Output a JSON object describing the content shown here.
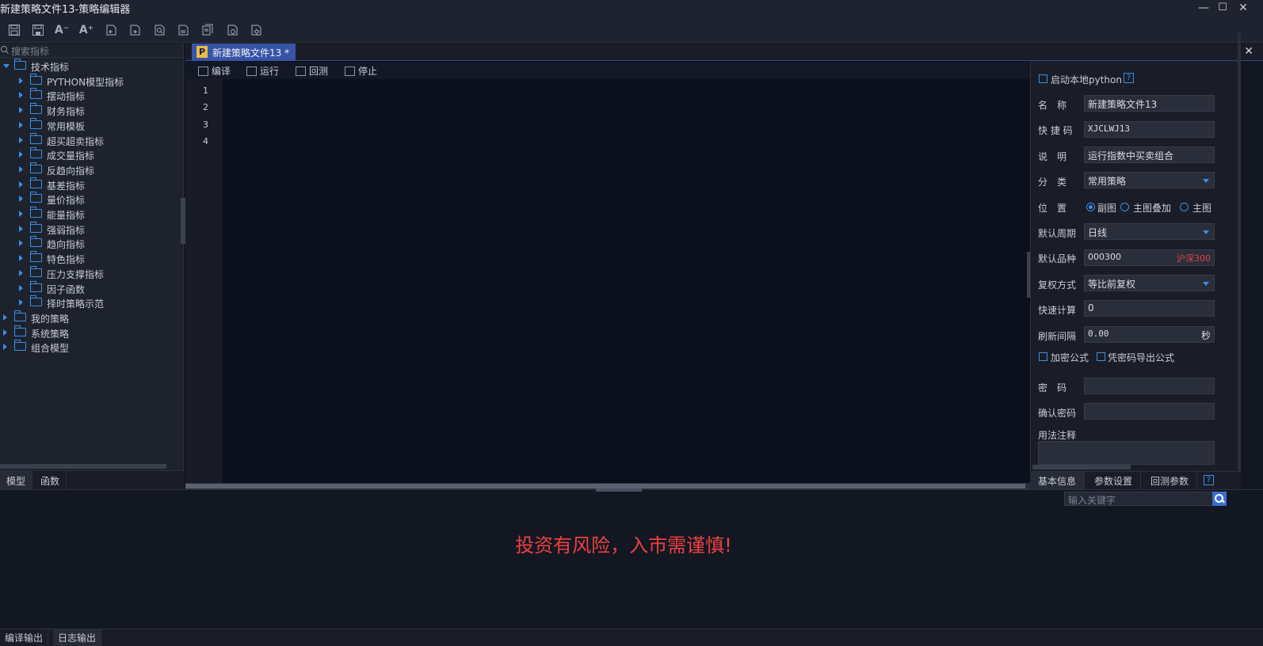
{
  "window": {
    "title": "新建策略文件13-策略编辑器",
    "minimize": "—",
    "maximize": "☐",
    "close": "✕"
  },
  "toolbar": {
    "icons": [
      "save-icon",
      "save-as-icon",
      "font-decrease-icon",
      "font-increase-icon",
      "undo-icon",
      "redo-icon",
      "find-icon",
      "import-icon",
      "export-icon",
      "settings-doc-icon",
      "gear-doc-icon"
    ],
    "font_decrease": "A⁻",
    "font_increase": "A⁺"
  },
  "left_panel": {
    "search_placeholder": "搜索指标",
    "tree": [
      {
        "label": "技术指标",
        "level": 0,
        "open": true
      },
      {
        "label": "PYTHON模型指标",
        "level": 1
      },
      {
        "label": "摆动指标",
        "level": 1
      },
      {
        "label": "财务指标",
        "level": 1
      },
      {
        "label": "常用模板",
        "level": 1
      },
      {
        "label": "超买超卖指标",
        "level": 1
      },
      {
        "label": "成交量指标",
        "level": 1
      },
      {
        "label": "反趋向指标",
        "level": 1
      },
      {
        "label": "基差指标",
        "level": 1
      },
      {
        "label": "量价指标",
        "level": 1
      },
      {
        "label": "能量指标",
        "level": 1
      },
      {
        "label": "强弱指标",
        "level": 1
      },
      {
        "label": "趋向指标",
        "level": 1
      },
      {
        "label": "特色指标",
        "level": 1
      },
      {
        "label": "压力支撑指标",
        "level": 1
      },
      {
        "label": "因子函数",
        "level": 1
      },
      {
        "label": "择时策略示范",
        "level": 1
      },
      {
        "label": "我的策略",
        "level": 0
      },
      {
        "label": "系统策略",
        "level": 0
      },
      {
        "label": "组合模型",
        "level": 0
      }
    ],
    "tabs": [
      "模型",
      "函数"
    ]
  },
  "editor": {
    "tab_label": "新建策略文件13 *",
    "tab_icon": "P",
    "close": "✕",
    "tools": [
      "编译",
      "运行",
      "回测",
      "停止"
    ],
    "line_numbers": [
      "1",
      "2",
      "3",
      "4"
    ]
  },
  "properties": {
    "local_python": "启动本地python",
    "help": "?",
    "name_label": "名　称",
    "name_value": "新建策略文件13",
    "shortcut_label": "快 捷 码",
    "shortcut_value": "XJCLWJ13",
    "desc_label": "说　明",
    "desc_value": "运行指数中买卖组合",
    "category_label": "分　类",
    "category_value": "常用策略",
    "position_label": "位　置",
    "position_options": [
      "副图",
      "主图叠加",
      "主图"
    ],
    "position_selected": "副图",
    "period_label": "默认周期",
    "period_value": "日线",
    "symbol_label": "默认品种",
    "symbol_value": "000300",
    "symbol_name": "沪深300",
    "adjust_label": "复权方式",
    "adjust_value": "等比前复权",
    "quick_calc_label": "快速计算",
    "quick_calc_value": "0",
    "refresh_label": "刷新间隔",
    "refresh_value": "0.00",
    "refresh_unit": "秒",
    "encrypt_label": "加密公式",
    "export_pw_label": "凭密码导出公式",
    "password_label": "密　码",
    "confirm_pw_label": "确认密码",
    "usage_label": "用法注释",
    "tabs": [
      "基本信息",
      "参数设置",
      "回测参数"
    ]
  },
  "output": {
    "search_placeholder": "输入关键字",
    "warning": "投资有风险，入市需谨慎!",
    "tabs": [
      "编译输出",
      "日志输出"
    ]
  },
  "colors": {
    "accent": "#3a8ee6",
    "tab_active": "#3854a6",
    "warning": "#ef4040"
  }
}
